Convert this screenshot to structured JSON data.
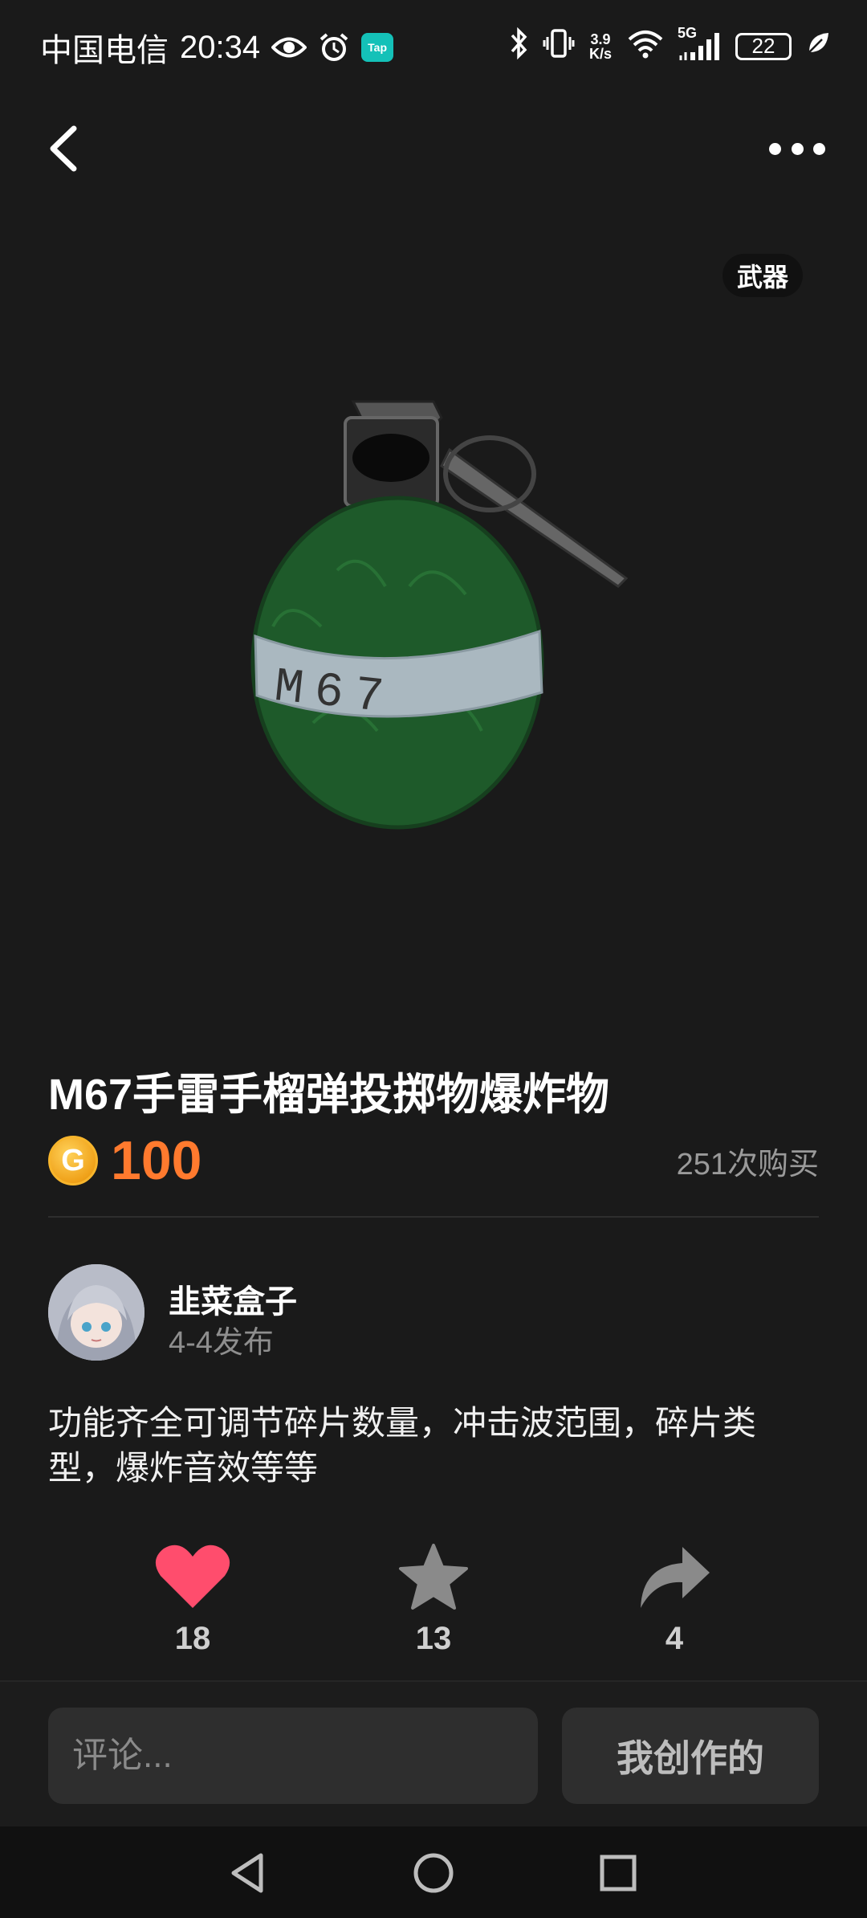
{
  "status_bar": {
    "carrier": "中国电信",
    "time": "20:34",
    "tap_badge": "Tap",
    "net_speed_value": "3.9",
    "net_speed_unit": "K/s",
    "network_type": "5G",
    "battery": "22",
    "icons": [
      "eye-icon",
      "alarm-icon",
      "tap-app-icon",
      "bluetooth-icon",
      "vibrate-icon",
      "wifi-icon",
      "signal-icon",
      "battery-icon",
      "leaf-icon"
    ]
  },
  "nav": {
    "back_icon": "chevron-left-icon",
    "more_icon": "more-dots-icon"
  },
  "item": {
    "tag": "武器",
    "title": "M67手雷手榴弹投掷物爆炸物",
    "price": "100",
    "purchase_count": "251次购买",
    "hero_label": "M67"
  },
  "author": {
    "name": "韭菜盒子",
    "publish_date": "4-4发布"
  },
  "description": "功能齐全可调节碎片数量，冲击波范围，碎片类型，爆炸音效等等",
  "actions": {
    "likes": "18",
    "favorites": "13",
    "shares": "4"
  },
  "bottom": {
    "comment_placeholder": "评论...",
    "my_creations_label": "我创作的"
  },
  "colors": {
    "background": "#1a1a1a",
    "price": "#ff7a2e",
    "like": "#ff4d6d",
    "coin": "#f0a21a",
    "grenade_body": "#1e5a2a"
  }
}
